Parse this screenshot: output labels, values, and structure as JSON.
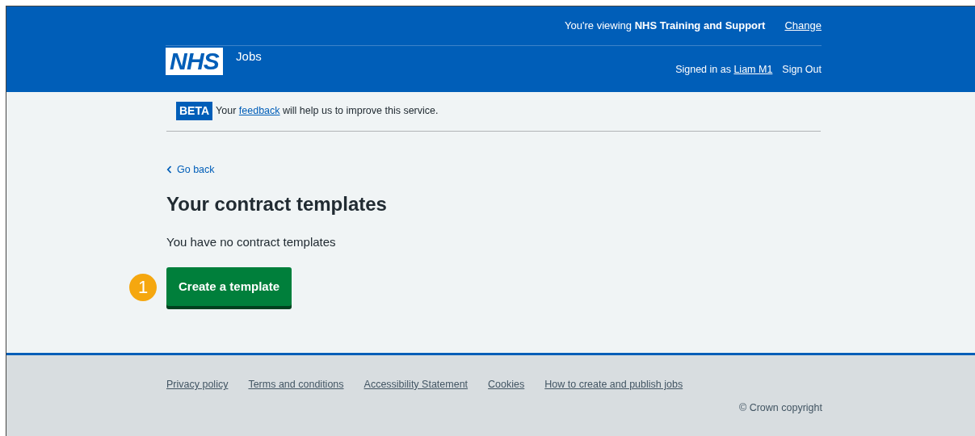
{
  "header": {
    "logo": "NHS",
    "service": "Jobs",
    "viewing_prefix": "You're viewing",
    "organisation": "NHS Training and Support",
    "change_link": "Change",
    "signed_in_prefix": "Signed in as",
    "user_link": "Liam M1",
    "sign_out": "Sign Out"
  },
  "beta_banner": {
    "tag": "BETA",
    "text_before": "Your",
    "link": "feedback",
    "text_after": "will help us to improve this service."
  },
  "back_link": "Go back",
  "heading": "Your contract templates",
  "body": "You have no contract templates",
  "step_marker": "1",
  "primary_button": "Create a template",
  "footer": {
    "links": [
      "Privacy policy",
      "Terms and conditions",
      "Accessibility Statement",
      "Cookies",
      "How to create and publish jobs"
    ],
    "copyright": "© Crown copyright"
  }
}
